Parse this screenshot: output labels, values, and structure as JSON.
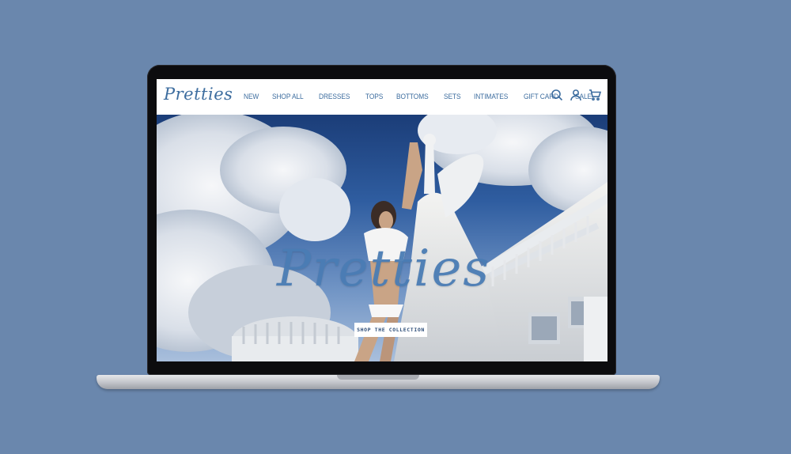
{
  "brand": {
    "logo_text": "Pretties",
    "accent_color": "#3d6d9f"
  },
  "nav": {
    "links": [
      "NEW",
      "SHOP ALL",
      "DRESSES",
      "TOPS",
      "BOTTOMS",
      "SETS",
      "INTIMATES",
      "GIFT CARD",
      "SALE"
    ],
    "icons": [
      "search-icon",
      "account-icon",
      "cart-icon"
    ]
  },
  "hero": {
    "wordmark": "Pretties",
    "cta_label": "SHOP THE COLLECTION"
  }
}
